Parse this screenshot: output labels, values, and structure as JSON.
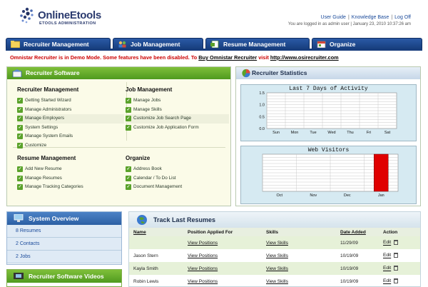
{
  "header": {
    "logo_text": "OnlineEtools",
    "logo_sub": "ETOOLS ADMINISTRATION",
    "links": [
      "User Guide",
      "Knowledge Base",
      "Log Off"
    ],
    "login_status": "You are logged in as admin user | January 23, 2010 10:37:26 am"
  },
  "tabs": [
    {
      "label": "Recruiter Management"
    },
    {
      "label": "Job Management"
    },
    {
      "label": "Resume Management"
    },
    {
      "label": "Organize"
    }
  ],
  "demo_notice": {
    "text": "Omnistar Recruiter is in Demo Mode. Some features have been disabled. To ",
    "link1": "Buy Omnistar Recruiter",
    "mid": " visit ",
    "link2": "http://www.osirecruiter.com"
  },
  "recruiter_software": {
    "title": "Recruiter Software",
    "recruiter_management": {
      "heading": "Recruiter Management",
      "items": [
        "Getting Started Wizard",
        "Manage Administrators",
        "Manage Employers",
        "System Settings",
        "Manage System Emails",
        "Customize"
      ]
    },
    "job_management": {
      "heading": "Job Management",
      "items": [
        "Manage Jobs",
        "Manage Skills",
        "Customize Job Search Page",
        "Customize Job Application Form"
      ]
    },
    "resume_management": {
      "heading": "Resume Management",
      "items": [
        "Add New Resume",
        "Manage Resumes",
        "Manage Tracking Categories"
      ]
    },
    "organize": {
      "heading": "Organize",
      "items": [
        "Address Book",
        "Calendar / To Do List",
        "Document Management"
      ]
    }
  },
  "recruiter_statistics": {
    "title": "Recruiter Statistics"
  },
  "system_overview": {
    "title": "System Overview",
    "items": [
      "8 Resumes",
      "2 Contacts",
      "2 Jobs"
    ]
  },
  "videos": {
    "title": "Recruiter Software Videos"
  },
  "track_resumes": {
    "title": "Track Last Resumes",
    "columns": [
      "Name",
      "Position Applied For",
      "Skills",
      "Date Added",
      "Action"
    ],
    "rows": [
      {
        "name": "",
        "position": "View Positions",
        "skills": "View Skills",
        "date": "11/29/09",
        "edit": "Edit"
      },
      {
        "name": "Jason  Stern",
        "position": "View Positions",
        "skills": "View Skills",
        "date": "10/19/09",
        "edit": "Edit"
      },
      {
        "name": "Kayla  Smith",
        "position": "View Positions",
        "skills": "View Skills",
        "date": "10/19/09",
        "edit": "Edit"
      },
      {
        "name": "Robin  Lewis",
        "position": "View Positions",
        "skills": "View Skills",
        "date": "10/19/09",
        "edit": "Edit"
      }
    ]
  },
  "chart_data": [
    {
      "type": "bar",
      "title": "Last 7 Days of Activity",
      "categories": [
        "Sun",
        "Mon",
        "Tue",
        "Wed",
        "Thu",
        "Fri",
        "Sat"
      ],
      "values": [
        0,
        0,
        0,
        0,
        0,
        0,
        0
      ],
      "ylim": [
        0,
        1.5
      ],
      "yticks": [
        "0.0",
        "0.5",
        "1.0",
        "1.5"
      ],
      "grid": true
    },
    {
      "type": "bar",
      "title": "Web Visitors",
      "categories": [
        "Oct",
        "Nov",
        "Dec",
        "Jan"
      ],
      "values": [
        0,
        0,
        0,
        1
      ],
      "ylim": [
        0,
        1
      ],
      "grid": true,
      "bar_color": "#e00000"
    }
  ]
}
